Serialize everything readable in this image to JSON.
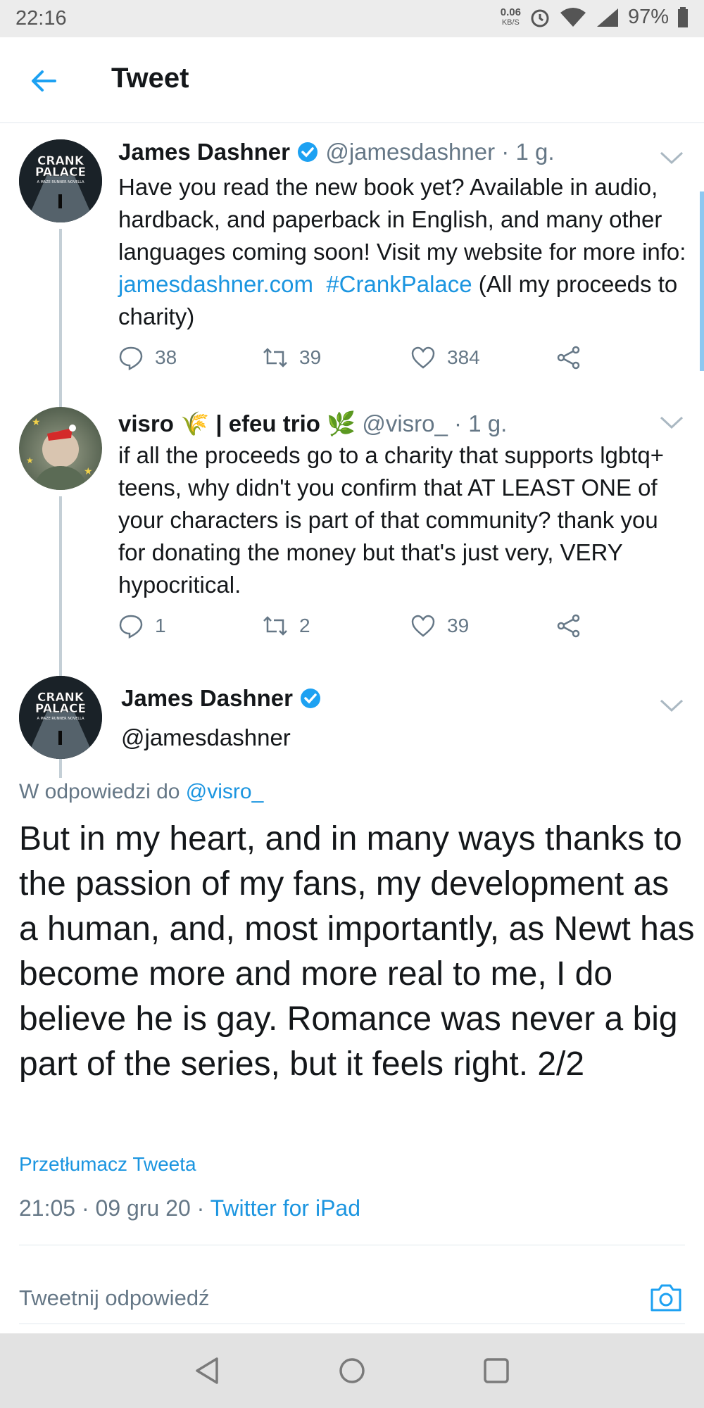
{
  "status_bar": {
    "time": "22:16",
    "net_speed": "0.06",
    "net_unit": "KB/S",
    "battery": "97%"
  },
  "header": {
    "title": "Tweet"
  },
  "tweet1": {
    "name": "James Dashner",
    "handle": "@jamesdashner",
    "time": "· 1 g.",
    "avatar_line1": "CRANK",
    "avatar_line2": "PALACE",
    "avatar_line3": "A MAZE RUNNER NOVELLA",
    "text_before": "Have you read the new book yet? Available in audio, hardback, and paperback in English, and many other languages coming soon! Visit my website for more info: ",
    "link": "jamesdashner.com",
    "hashtag": "#CrankPalace",
    "text_after": " (All my proceeds to charity)",
    "replies": "38",
    "retweets": "39",
    "likes": "384"
  },
  "tweet2": {
    "name": "visro",
    "name_icon": "🌾",
    "name_part2": "| efeu trio",
    "name_icon2": "🌿",
    "handle": "@visro_",
    "time": "· 1 g.",
    "text": "if all the proceeds go to a charity that supports lgbtq+ teens, why didn't you confirm that AT LEAST ONE of your characters is part of that community? thank you for donating the money but that's just very, VERY hypocritical.",
    "replies": "1",
    "retweets": "2",
    "likes": "39"
  },
  "main_tweet": {
    "name": "James Dashner",
    "handle": "@jamesdashner",
    "avatar_line1": "CRANK",
    "avatar_line2": "PALACE",
    "avatar_line3": "A MAZE RUNNER NOVELLA",
    "reply_to_prefix": "W odpowiedzi do ",
    "reply_to_handle": "@visro_",
    "text": "But in my heart, and in many ways thanks to the passion of my fans, my development as a human, and, most importantly, as Newt has become more and more real to me, I do believe he is gay. Romance was never a big part of the series, but it feels right. 2/2",
    "translate": "Przetłumacz Tweeta",
    "timestamp": "21:05 · 09 gru 20 · ",
    "source": "Twitter for iPad"
  },
  "reply_bar": {
    "placeholder": "Tweetnij odpowiedź"
  },
  "colors": {
    "link": "#1b95e0",
    "verified": "#1da1f2",
    "muted": "#657786"
  }
}
